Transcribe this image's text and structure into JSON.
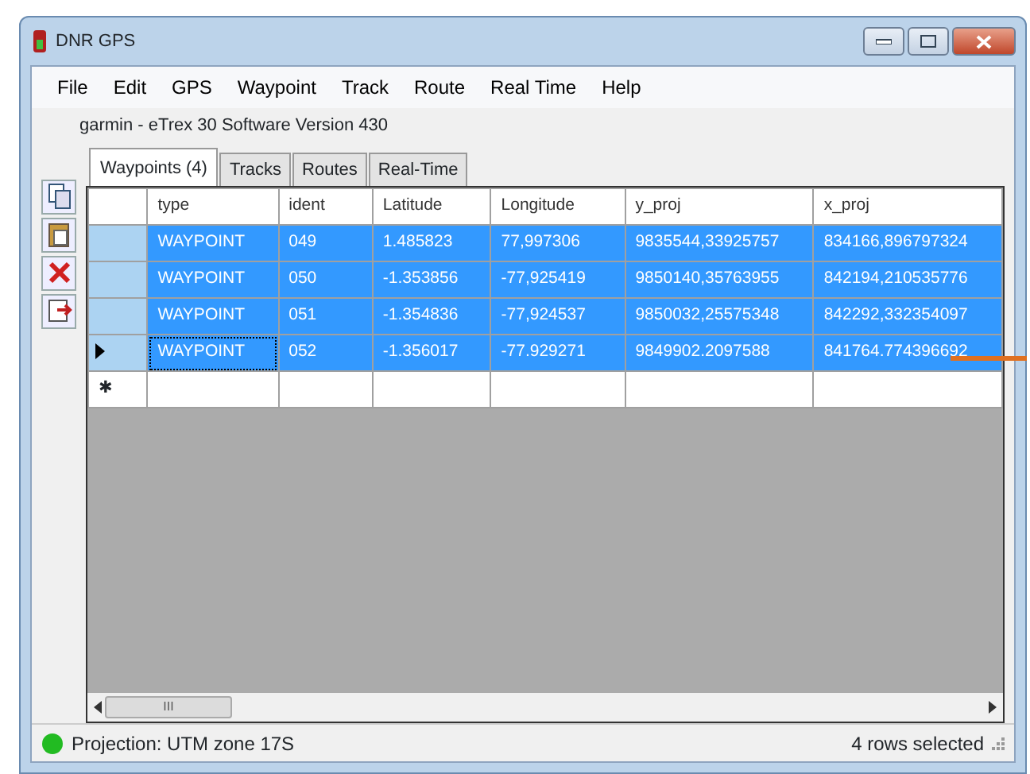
{
  "window": {
    "title": "DNR GPS"
  },
  "menu": [
    "File",
    "Edit",
    "GPS",
    "Waypoint",
    "Track",
    "Route",
    "Real Time",
    "Help"
  ],
  "device_label": "garmin - eTrex 30 Software Version 430",
  "tabs": [
    {
      "label": "Waypoints (4)",
      "selected": true
    },
    {
      "label": "Tracks",
      "selected": false
    },
    {
      "label": "Routes",
      "selected": false
    },
    {
      "label": "Real-Time",
      "selected": false
    }
  ],
  "toolbar": [
    {
      "kind": "copy"
    },
    {
      "kind": "paste"
    },
    {
      "kind": "delete"
    },
    {
      "kind": "export"
    }
  ],
  "table": {
    "columns": [
      "type",
      "ident",
      "Latitude",
      "Longitude",
      "y_proj",
      "x_proj"
    ],
    "rows": [
      {
        "selected": true,
        "current": false,
        "cells": [
          "WAYPOINT",
          "049",
          "1.485823",
          "77,997306",
          "9835544,33925757",
          "834166,896797324"
        ]
      },
      {
        "selected": true,
        "current": false,
        "cells": [
          "WAYPOINT",
          "050",
          "-1.353856",
          "-77,925419",
          "9850140,35763955",
          "842194,210535776"
        ]
      },
      {
        "selected": true,
        "current": false,
        "cells": [
          "WAYPOINT",
          "051",
          "-1.354836",
          "-77,924537",
          "9850032,25575348",
          "842292,332354097"
        ]
      },
      {
        "selected": true,
        "current": true,
        "cells": [
          "WAYPOINT",
          "052",
          "-1.356017",
          "-77.929271",
          "9849902.2097588",
          "841764.774396692"
        ]
      }
    ],
    "new_row_marker": "✱",
    "scroll_thumb": "III"
  },
  "status_bar": {
    "projection": "Projection: UTM zone 17S",
    "connected": true,
    "selection": "4 rows selected"
  }
}
